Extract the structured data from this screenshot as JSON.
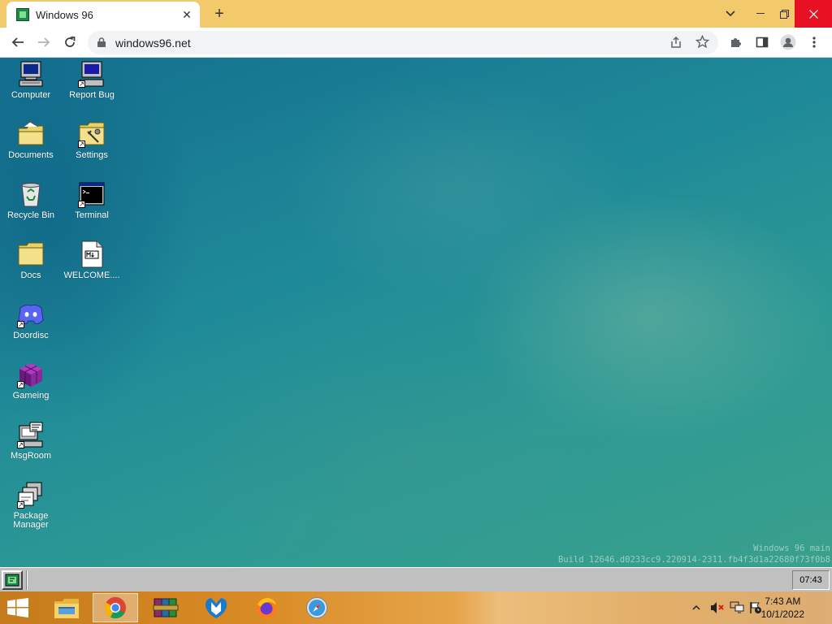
{
  "browser": {
    "tab_title": "Windows 96",
    "url": "windows96.net"
  },
  "desktop": {
    "icons": [
      {
        "label": "Computer",
        "icon": "computer-icon"
      },
      {
        "label": "Report Bug",
        "icon": "report-bug-icon"
      },
      {
        "label": "Documents",
        "icon": "documents-folder-icon"
      },
      {
        "label": "Settings",
        "icon": "settings-folder-icon"
      },
      {
        "label": "Recycle Bin",
        "icon": "recycle-bin-icon"
      },
      {
        "label": "Terminal",
        "icon": "terminal-icon"
      },
      {
        "label": "Docs",
        "icon": "folder-icon"
      },
      {
        "label": "WELCOME....",
        "icon": "markdown-file-icon"
      },
      {
        "label": "Doordisc",
        "icon": "doordisc-icon"
      },
      {
        "label": "Gameing",
        "icon": "gameing-icon"
      },
      {
        "label": "MsgRoom",
        "icon": "msgroom-icon"
      },
      {
        "label": "Package Manager",
        "icon": "package-manager-icon"
      }
    ],
    "build_line1": "Windows 96 main",
    "build_line2": "Build 12646.d0233cc9.220914-2311.fb4f3d1a22680f73f0b8"
  },
  "w96_taskbar": {
    "clock": "07:43"
  },
  "host_taskbar": {
    "apps": [
      "file-explorer-icon",
      "chrome-icon",
      "winrar-icon",
      "malwarebytes-icon",
      "firefox-icon",
      "safari-icon"
    ],
    "time": "7:43 AM",
    "date": "10/1/2022"
  }
}
